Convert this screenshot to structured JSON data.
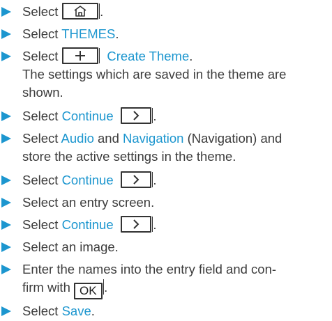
{
  "colors": {
    "accent": "#1c96cf",
    "text": "#3c3c3c"
  },
  "icons": {
    "home": "home-icon",
    "plus": "plus-icon",
    "chevron": "chevron-right-icon",
    "bullet": "triangle-bullet-icon"
  },
  "steps": [
    {
      "prefix": "Select ",
      "suffix": "."
    },
    {
      "prefix": "Select ",
      "kw": "THEMES",
      "suffix": "."
    },
    {
      "prefix": "Select ",
      "kw": "Create Theme",
      "suffix": ".",
      "line2": "The settings which are saved in the theme are",
      "line3": "shown."
    },
    {
      "prefix": "Select ",
      "kw": "Continue",
      "suffix": "."
    },
    {
      "prefix": "Select ",
      "kw": "Audio",
      "mid": " and ",
      "kw2": "Navigation",
      "suffix": " (Navigation) and",
      "line2": "store the active settings in the theme."
    },
    {
      "prefix": "Select ",
      "kw": "Continue",
      "suffix": "."
    },
    {
      "prefix": "Select an entry screen."
    },
    {
      "prefix": "Select ",
      "kw": "Continue",
      "suffix": "."
    },
    {
      "prefix": "Select an image."
    },
    {
      "prefix": "Enter the names into the entry field and con-",
      "line2_prefix": "firm with ",
      "key": "OK",
      "line2_suffix": "."
    },
    {
      "prefix": "Select ",
      "kw": "Save",
      "suffix": "."
    }
  ]
}
